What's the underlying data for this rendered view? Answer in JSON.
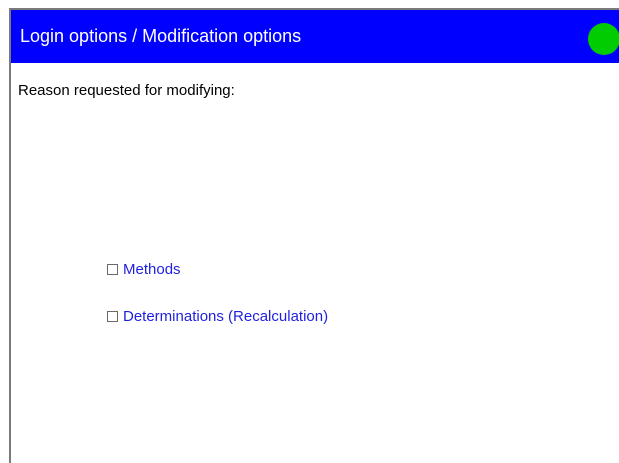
{
  "window": {
    "title": "Login options / Modification options",
    "status_indicator": {
      "icon": "status-circle-icon",
      "color": "#00cc00"
    },
    "accent_color": "#0000ff"
  },
  "form": {
    "reason_label": "Reason requested for modifying:",
    "options": [
      {
        "label": "Methods",
        "checked": false
      },
      {
        "label": "Determinations (Recalculation)",
        "checked": false
      }
    ]
  }
}
